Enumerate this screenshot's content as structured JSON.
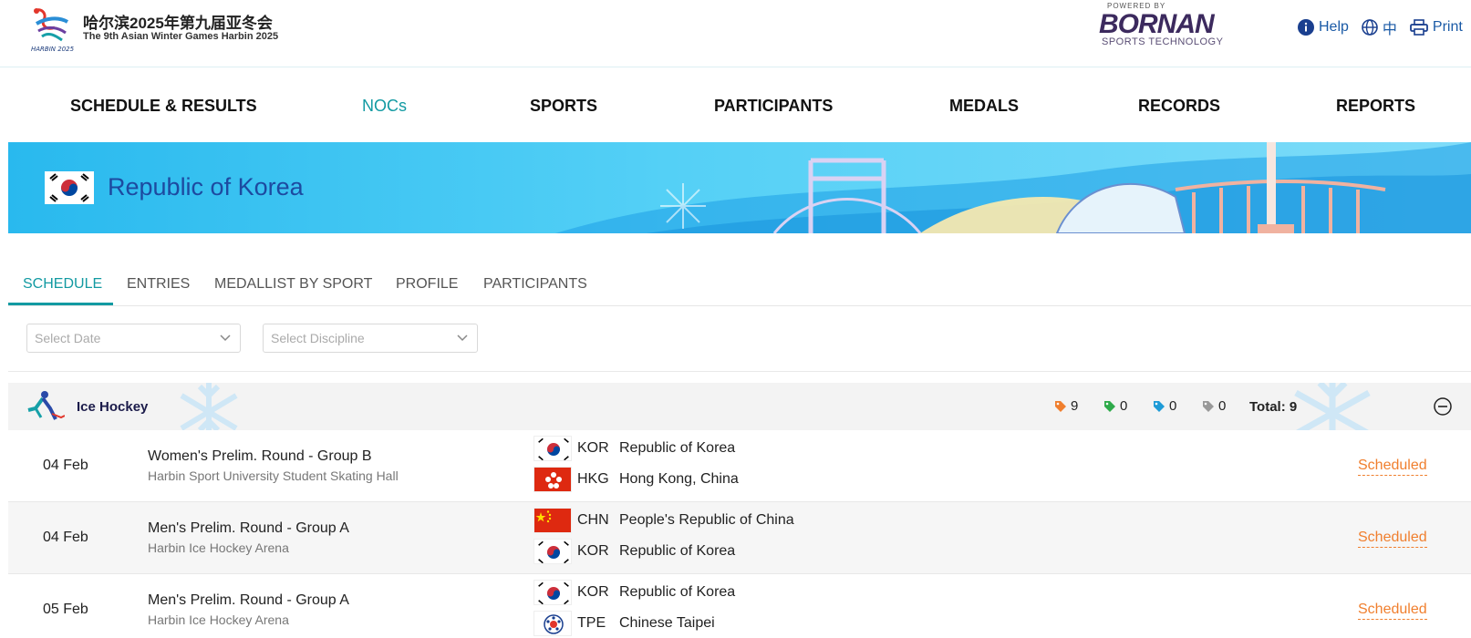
{
  "header": {
    "title_cn": "哈尔滨2025年第九届亚冬会",
    "title_en": "The 9th Asian Winter Games Harbin 2025",
    "logo_text": "HARBIN 2025",
    "powered_by": "POWERED BY",
    "sponsor": "BORNAN",
    "sponsor_sub": "SPORTS TECHNOLOGY",
    "links": {
      "help": "Help",
      "language": "中",
      "print": "Print"
    }
  },
  "nav": [
    {
      "label": "SCHEDULE & RESULTS",
      "active": false
    },
    {
      "label": "NOCs",
      "active": true
    },
    {
      "label": "SPORTS",
      "active": false
    },
    {
      "label": "PARTICIPANTS",
      "active": false
    },
    {
      "label": "MEDALS",
      "active": false
    },
    {
      "label": "RECORDS",
      "active": false
    },
    {
      "label": "REPORTS",
      "active": false
    }
  ],
  "banner": {
    "country": "Republic of Korea",
    "flag": "kor-flag-icon"
  },
  "tabs": [
    {
      "label": "SCHEDULE",
      "active": true
    },
    {
      "label": "ENTRIES",
      "active": false
    },
    {
      "label": "MEDALLIST BY SPORT",
      "active": false
    },
    {
      "label": "PROFILE",
      "active": false
    },
    {
      "label": "PARTICIPANTS",
      "active": false
    }
  ],
  "filters": {
    "date_placeholder": "Select Date",
    "discipline_placeholder": "Select Discipline"
  },
  "sport": {
    "name": "Ice Hockey",
    "counts": [
      {
        "value": "9",
        "color": "#f07f2e"
      },
      {
        "value": "0",
        "color": "#2eaa4a"
      },
      {
        "value": "0",
        "color": "#1e9bd7"
      },
      {
        "value": "0",
        "color": "#999999"
      }
    ],
    "total": "Total: 9"
  },
  "schedule": [
    {
      "date": "04 Feb",
      "event": "Women's Prelim. Round - Group B",
      "venue": "Harbin Sport University Student Skating Hall",
      "teams": [
        {
          "code": "KOR",
          "name": "Republic of Korea",
          "flag": "kor"
        },
        {
          "code": "HKG",
          "name": "Hong Kong, China",
          "flag": "hkg"
        }
      ],
      "status": "Scheduled"
    },
    {
      "date": "04 Feb",
      "event": "Men's Prelim. Round - Group A",
      "venue": "Harbin Ice Hockey Arena",
      "teams": [
        {
          "code": "CHN",
          "name": "People's Republic of China",
          "flag": "chn"
        },
        {
          "code": "KOR",
          "name": "Republic of Korea",
          "flag": "kor"
        }
      ],
      "status": "Scheduled"
    },
    {
      "date": "05 Feb",
      "event": "Men's Prelim. Round - Group A",
      "venue": "Harbin Ice Hockey Arena",
      "teams": [
        {
          "code": "KOR",
          "name": "Republic of Korea",
          "flag": "kor"
        },
        {
          "code": "TPE",
          "name": "Chinese Taipei",
          "flag": "tpe"
        }
      ],
      "status": "Scheduled"
    }
  ]
}
